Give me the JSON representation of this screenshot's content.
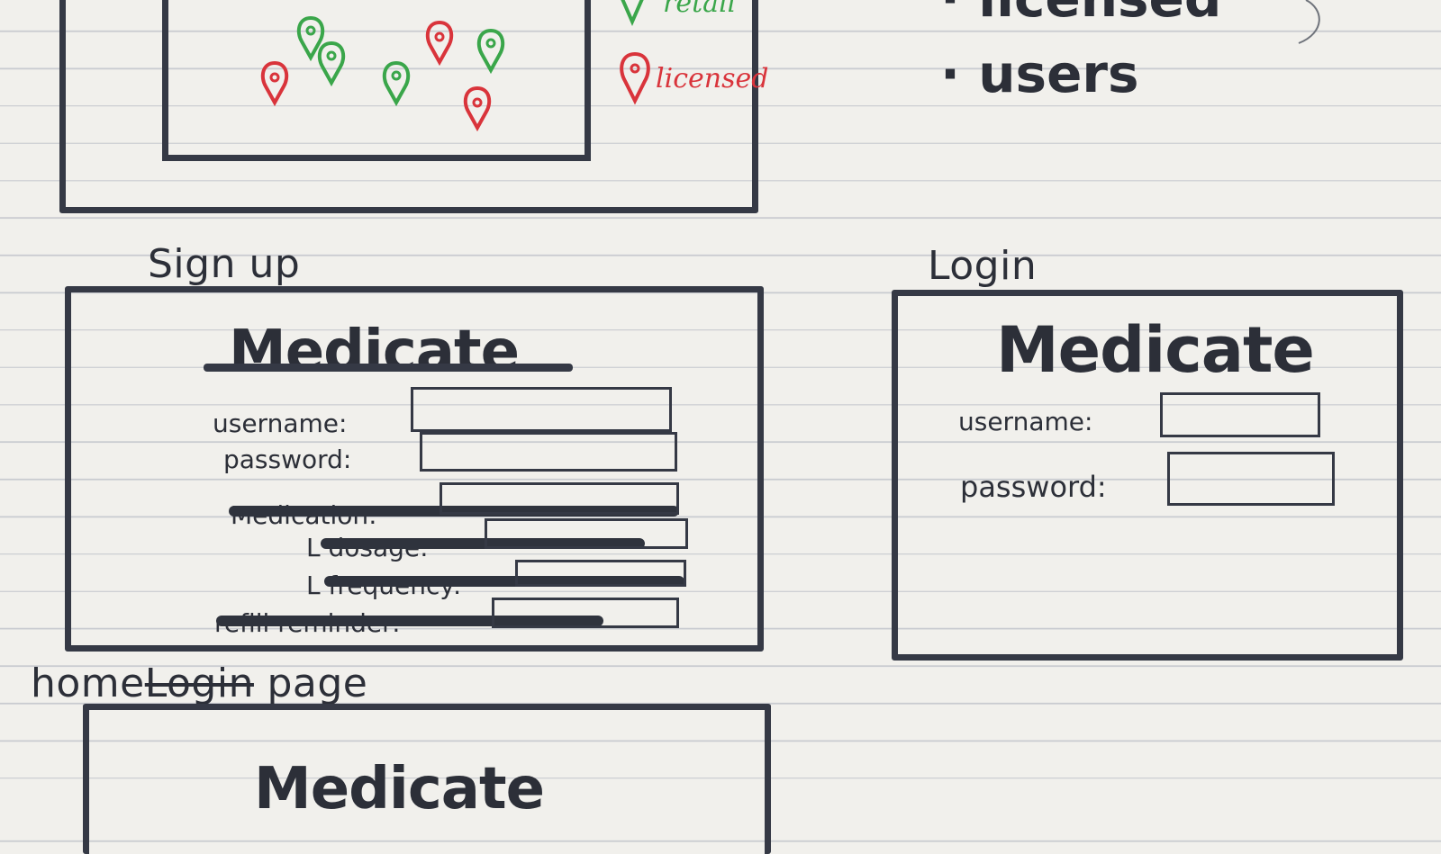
{
  "map_sketch": {
    "pins": [
      {
        "color": "green"
      },
      {
        "color": "green"
      },
      {
        "color": "green"
      },
      {
        "color": "green"
      },
      {
        "color": "red"
      },
      {
        "color": "red"
      },
      {
        "color": "red"
      }
    ],
    "legend": {
      "retail": {
        "label": "retail",
        "color": "#3aa64a"
      },
      "licensed": {
        "label": "licensed",
        "color": "#d9343b"
      }
    }
  },
  "notes": {
    "bullets": [
      "licensed",
      "users"
    ]
  },
  "signup": {
    "caption": "Sign up",
    "brand": "Medicate",
    "username_label": "username:",
    "password_label": "password:",
    "struck_medication": "Medication:",
    "struck_dosage": "L dosage:",
    "struck_frequency": "L frequency:",
    "struck_refill": "refill reminder:"
  },
  "login": {
    "caption": "Login",
    "brand": "Medicate",
    "username_label": "username:",
    "password_label": "password:"
  },
  "home": {
    "caption_prefix": "home",
    "caption_struck": "Login",
    "caption_suffix": "page",
    "brand": "Medicate"
  },
  "colors": {
    "ink": "#2c2f38",
    "green": "#3aa64a",
    "red": "#d9343b",
    "paper": "#f1f0ec"
  }
}
